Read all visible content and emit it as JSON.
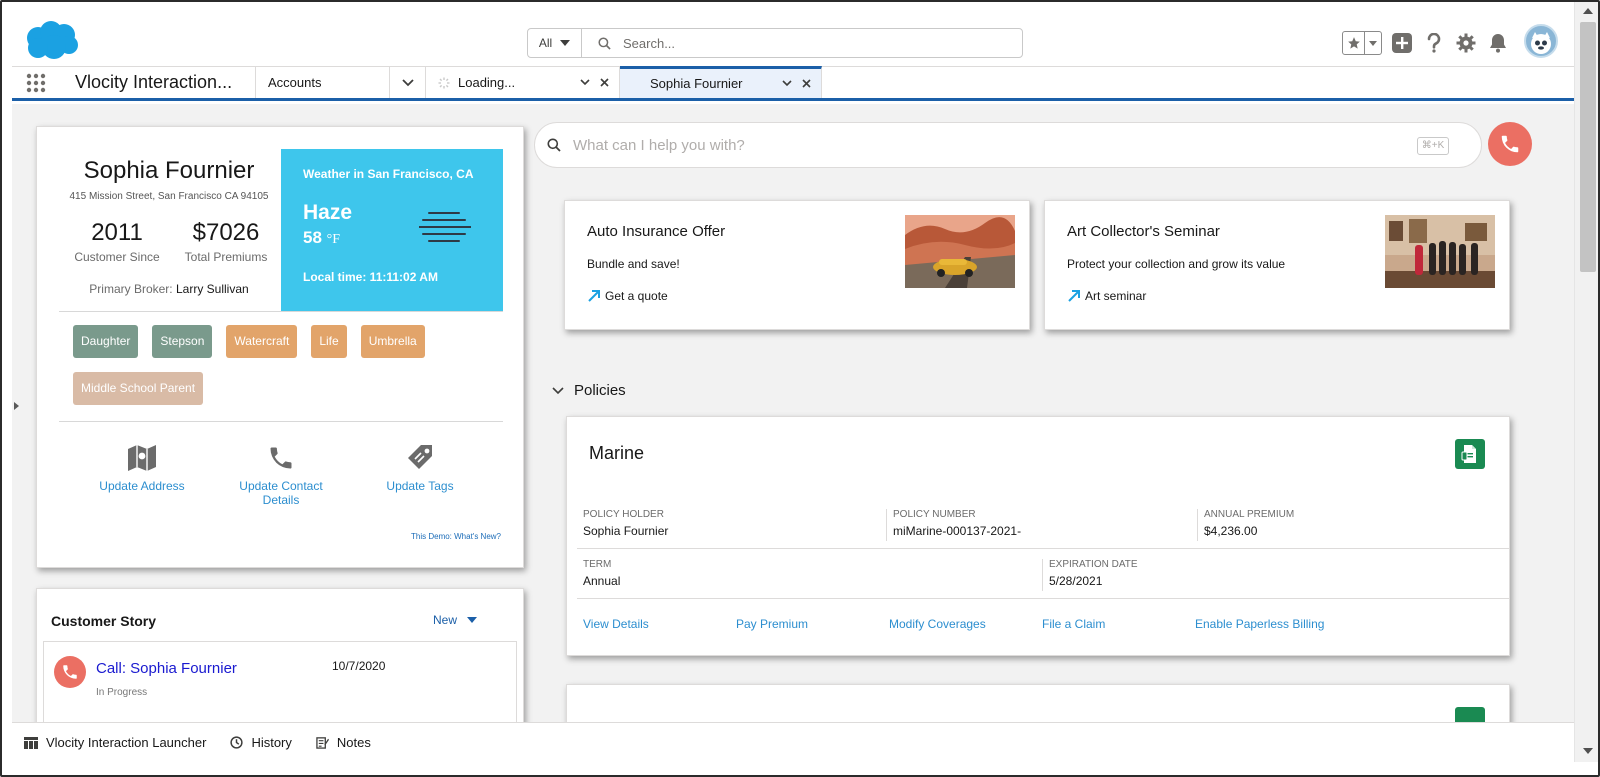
{
  "header": {
    "search_scope": "All",
    "search_placeholder": "Search..."
  },
  "nav": {
    "app_name": "Vlocity Interaction...",
    "tabs": [
      {
        "label": "Accounts"
      },
      {
        "label": "Loading..."
      },
      {
        "label": "Sophia Fournier"
      }
    ]
  },
  "profile": {
    "name": "Sophia Fournier",
    "address": "415 Mission Street, San Francisco CA 94105",
    "customer_since": "2011",
    "customer_since_label": "Customer Since",
    "total_premiums": "$7026",
    "total_premiums_label": "Total Premiums",
    "broker_label": "Primary Broker:",
    "broker_name": "Larry Sullivan",
    "weather": {
      "title": "Weather in San Francisco, CA",
      "condition": "Haze",
      "temp": "58",
      "unit": "°F",
      "local_time": "Local time: 11:11:02 AM"
    },
    "tags": [
      {
        "label": "Daughter",
        "color": "#7a9a8c"
      },
      {
        "label": "Stepson",
        "color": "#7a9a8c"
      },
      {
        "label": "Watercraft",
        "color": "#e2a46a"
      },
      {
        "label": "Life",
        "color": "#e2a46a"
      },
      {
        "label": "Umbrella",
        "color": "#e2a46a"
      },
      {
        "label": "Middle School Parent",
        "color": "#d9bba6"
      }
    ],
    "actions": [
      {
        "label": "Update Address"
      },
      {
        "label": "Update Contact Details"
      },
      {
        "label": "Update Tags"
      }
    ],
    "demo_link": "This Demo: What's New?"
  },
  "story": {
    "title": "Customer Story",
    "new_label": "New",
    "item": {
      "title": "Call: Sophia Fournier",
      "date": "10/7/2020",
      "status": "In Progress"
    }
  },
  "assistant": {
    "placeholder": "What can I help you with?",
    "shortcut": "⌘+K"
  },
  "offers": [
    {
      "title": "Auto Insurance Offer",
      "subtitle": "Bundle and save!",
      "link": "Get a quote"
    },
    {
      "title": "Art Collector's Seminar",
      "subtitle": "Protect your collection and grow its value",
      "link": "Art seminar"
    }
  ],
  "policies": {
    "section_label": "Policies",
    "marine": {
      "title": "Marine",
      "policy_holder_label": "POLICY HOLDER",
      "policy_holder": "Sophia Fournier",
      "policy_number_label": "POLICY NUMBER",
      "policy_number": "miMarine-000137-2021-",
      "annual_premium_label": "ANNUAL PREMIUM",
      "annual_premium": "$4,236.00",
      "term_label": "TERM",
      "term": "Annual",
      "expiration_label": "EXPIRATION DATE",
      "expiration": "5/28/2021",
      "links": [
        "View Details",
        "Pay Premium",
        "Modify Coverages",
        "File a Claim",
        "Enable Paperless Billing"
      ]
    }
  },
  "utility_bar": {
    "items": [
      {
        "label": "Vlocity Interaction Launcher"
      },
      {
        "label": "History"
      },
      {
        "label": "Notes"
      }
    ]
  },
  "colors": {
    "brand_blue": "#1b5fa8",
    "weather_bg": "#3ec6ec",
    "call_red": "#eb6f63",
    "policy_green": "#1a8a52",
    "link_blue": "#2c8ecf"
  }
}
